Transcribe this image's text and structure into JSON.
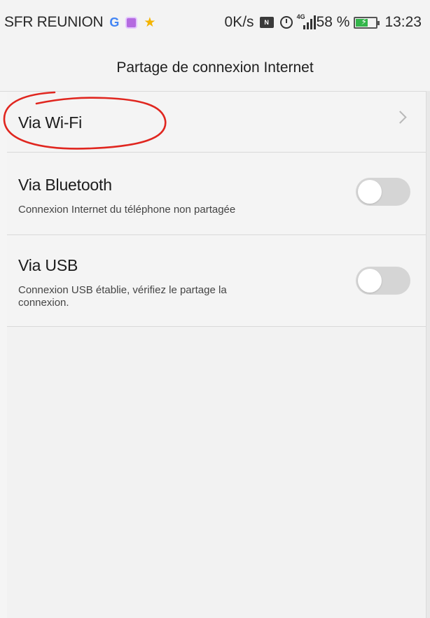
{
  "status_bar": {
    "carrier": "SFR REUNION",
    "app_icons": [
      "google-icon",
      "app-icon",
      "star-icon"
    ],
    "speed": "0K/s",
    "network_tag": "4G",
    "battery_percent": "58 %",
    "battery_level": 0.58,
    "time": "13:23"
  },
  "header": {
    "title": "Partage de connexion Internet"
  },
  "items": [
    {
      "title": "Via Wi-Fi",
      "control": "chevron"
    },
    {
      "title": "Via Bluetooth",
      "subtitle": "Connexion Internet du téléphone non partagée",
      "toggle_on": false
    },
    {
      "title": "Via USB",
      "subtitle_line1": "Connexion USB établie, vérifiez le partage la",
      "subtitle_line2": "connexion.",
      "toggle_on": false
    }
  ],
  "annotation": {
    "color": "#e0261f",
    "target": "Via Wi-Fi"
  },
  "colors": {
    "background": "#f2f2f2",
    "toggle_off": "#d5d5d5",
    "battery": "#33b54a"
  }
}
